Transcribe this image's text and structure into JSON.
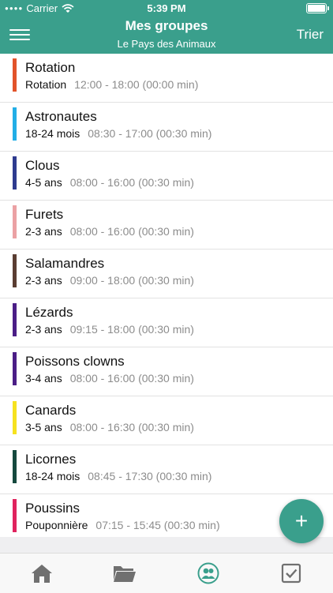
{
  "status_bar": {
    "carrier": "Carrier",
    "time": "5:39 PM"
  },
  "header": {
    "title": "Mes groupes",
    "subtitle": "Le Pays des Animaux",
    "sort_label": "Trier",
    "menu_icon": "menu-icon"
  },
  "groups": [
    {
      "name": "Rotation",
      "age": "Rotation",
      "time": "12:00 - 18:00 (00:00 min)",
      "color": "#e2532a"
    },
    {
      "name": "Astronautes",
      "age": "18-24 mois",
      "time": "08:30 - 17:00 (00:30 min)",
      "color": "#22aee6"
    },
    {
      "name": "Clous",
      "age": "4-5 ans",
      "time": "08:00 - 16:00 (00:30 min)",
      "color": "#2e3b8f"
    },
    {
      "name": "Furets",
      "age": "2-3 ans",
      "time": "08:00 - 16:00 (00:30 min)",
      "color": "#eba1a4"
    },
    {
      "name": "Salamandres",
      "age": "2-3 ans",
      "time": "09:00 - 18:00 (00:30 min)",
      "color": "#5a3d32"
    },
    {
      "name": "Lézards",
      "age": "2-3 ans",
      "time": "09:15 - 18:00 (00:30 min)",
      "color": "#4b1e86"
    },
    {
      "name": "Poissons clowns",
      "age": "3-4 ans",
      "time": "08:00 - 16:00 (00:30 min)",
      "color": "#4b1e86"
    },
    {
      "name": "Canards",
      "age": "3-5 ans",
      "time": "08:00 - 16:30 (00:30 min)",
      "color": "#f6e21f"
    },
    {
      "name": "Licornes",
      "age": "18-24 mois",
      "time": "08:45 - 17:30 (00:30 min)",
      "color": "#15493e"
    },
    {
      "name": "Poussins",
      "age": "Pouponnière",
      "time": "07:15 - 15:45 (00:30 min)",
      "color": "#e0235e"
    }
  ],
  "tabs": [
    {
      "icon": "home-icon",
      "active": false
    },
    {
      "icon": "folder-icon",
      "active": false
    },
    {
      "icon": "groups-icon",
      "active": true
    },
    {
      "icon": "checkbox-icon",
      "active": false
    }
  ],
  "fab": {
    "label": "+"
  },
  "colors": {
    "accent": "#3a9f8c",
    "tab_inactive": "#707070",
    "tab_active": "#3a9f8c"
  }
}
